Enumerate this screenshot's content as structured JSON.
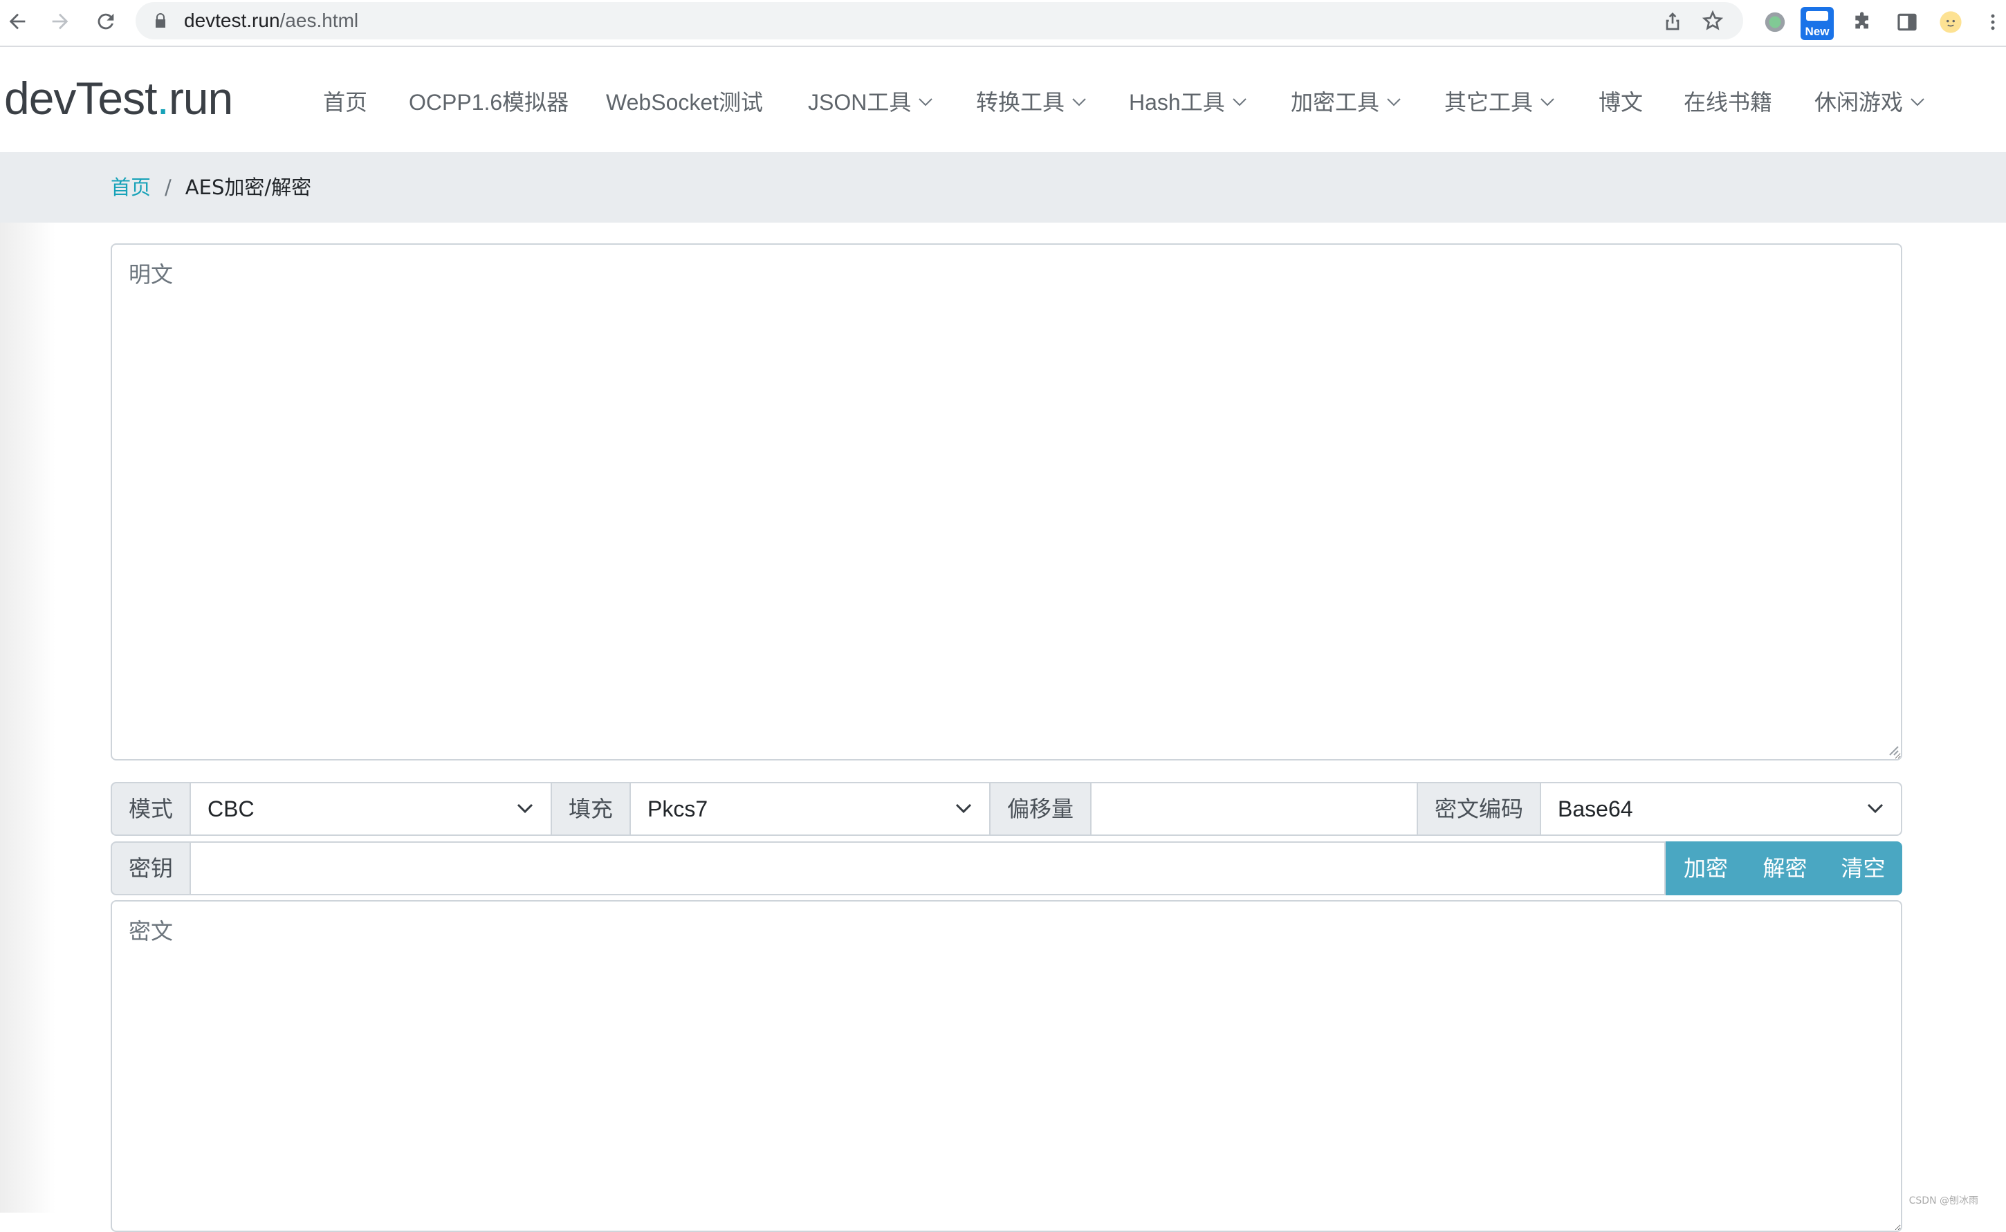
{
  "browser": {
    "url_host": "devtest.run",
    "url_path": "/aes.html",
    "extension_badge": "New"
  },
  "site": {
    "brand_prefix": "devTest",
    "brand_dot": ".",
    "brand_suffix": "run",
    "accent_color": "#17a2b8",
    "nav": [
      {
        "label": "首页"
      },
      {
        "label": "OCPP1.6模拟器"
      },
      {
        "label": "WebSocket测试"
      },
      {
        "label": "JSON工具"
      },
      {
        "label": "转换工具"
      },
      {
        "label": "Hash工具"
      },
      {
        "label": "加密工具"
      },
      {
        "label": "其它工具"
      },
      {
        "label": "博文"
      },
      {
        "label": "在线书籍"
      },
      {
        "label": "休闲游戏"
      }
    ]
  },
  "breadcrumb": {
    "home": "首页",
    "separator": "/",
    "current": "AES加密/解密"
  },
  "form": {
    "plaintext_placeholder": "明文",
    "mode_label": "模式",
    "mode_value": "CBC",
    "padding_label": "填充",
    "padding_value": "Pkcs7",
    "iv_label": "偏移量",
    "iv_value": "",
    "encoding_label": "密文编码",
    "encoding_value": "Base64",
    "key_label": "密钥",
    "key_value": "",
    "encrypt_button": "加密",
    "decrypt_button": "解密",
    "clear_button": "清空",
    "ciphertext_placeholder": "密文",
    "button_color": "#4aa7c2"
  },
  "watermark": "CSDN @刨冰雨"
}
